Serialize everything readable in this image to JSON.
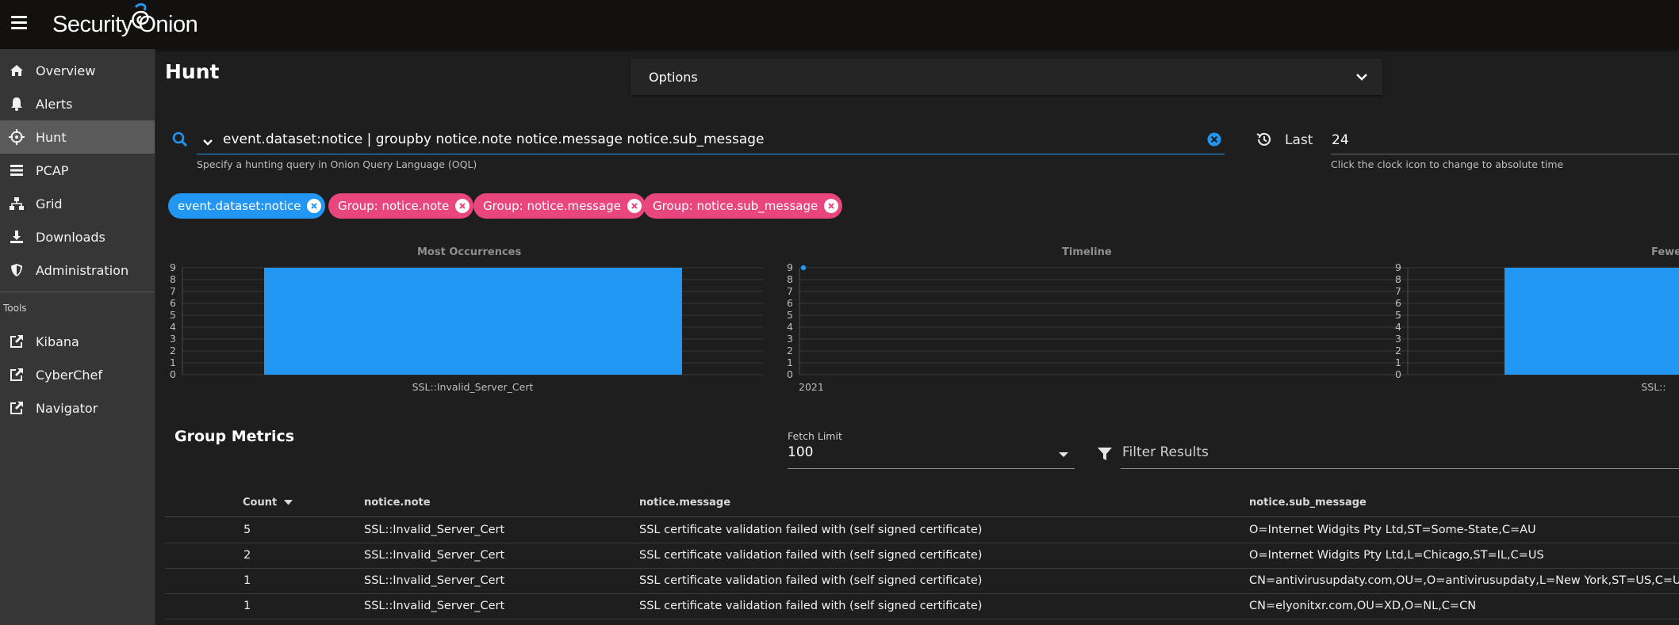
{
  "app": {
    "brand": "Security Onion",
    "brand_icon": "onion-swirl-logo",
    "accent": "#2196f3",
    "chip_pink": "#e8467c"
  },
  "sidebar": {
    "items": [
      {
        "label": "Overview",
        "icon": "home-icon"
      },
      {
        "label": "Alerts",
        "icon": "bell-icon"
      },
      {
        "label": "Hunt",
        "icon": "crosshairs-icon",
        "active": true
      },
      {
        "label": "PCAP",
        "icon": "list-icon"
      },
      {
        "label": "Grid",
        "icon": "sitemap-icon"
      },
      {
        "label": "Downloads",
        "icon": "download-icon"
      },
      {
        "label": "Administration",
        "icon": "shield-icon"
      }
    ],
    "tools_label": "Tools",
    "tools": [
      {
        "label": "Kibana",
        "icon": "external-link-icon"
      },
      {
        "label": "CyberChef",
        "icon": "external-link-icon"
      },
      {
        "label": "Navigator",
        "icon": "external-link-icon"
      }
    ]
  },
  "page": {
    "title": "Hunt"
  },
  "options": {
    "label": "Options"
  },
  "query": {
    "value": "event.dataset:notice | groupby notice.note notice.message notice.sub_message",
    "hint": "Specify a hunting query in Onion Query Language (OQL)"
  },
  "time": {
    "label": "Last",
    "value": "24",
    "hint": "Click the clock icon to change to absolute time"
  },
  "chips": [
    {
      "label": "event.dataset:notice",
      "color": "#2196f3"
    },
    {
      "label": "Group: notice.note",
      "color": "#e8467c"
    },
    {
      "label": "Group: notice.message",
      "color": "#e8467c"
    },
    {
      "label": "Group: notice.sub_message",
      "color": "#e8467c"
    }
  ],
  "chart_data": [
    {
      "type": "bar",
      "title": "Most Occurrences",
      "categories": [
        "SSL::Invalid_Server_Cert"
      ],
      "values": [
        9
      ],
      "ylim": [
        0,
        9
      ],
      "yticks": [
        "9",
        "8",
        "7",
        "6",
        "5",
        "4",
        "3",
        "2",
        "1",
        "0"
      ],
      "color": "#2196f3",
      "grid": true
    },
    {
      "type": "line",
      "title": "Timeline",
      "x": [
        "2021"
      ],
      "values": [
        9
      ],
      "ylim": [
        0,
        9
      ],
      "yticks": [
        "9",
        "8",
        "7",
        "6",
        "5",
        "4",
        "3",
        "2",
        "1",
        "0"
      ],
      "xtick_labels": [
        "2021"
      ],
      "color": "#2196f3",
      "grid": true
    },
    {
      "type": "bar",
      "title": "Fewe",
      "categories": [
        "SSL::"
      ],
      "values": [
        9
      ],
      "ylim": [
        0,
        9
      ],
      "yticks": [
        "9",
        "8",
        "7",
        "6",
        "5",
        "4",
        "3",
        "2",
        "1",
        "0"
      ],
      "color": "#2196f3",
      "grid": true
    }
  ],
  "group_metrics": {
    "title": "Group Metrics",
    "fetch_limit_label": "Fetch Limit",
    "fetch_limit_value": "100",
    "filter_placeholder": "Filter Results",
    "columns": [
      "Count",
      "notice.note",
      "notice.message",
      "notice.sub_message"
    ],
    "rows": [
      {
        "count": "5",
        "note": "SSL::Invalid_Server_Cert",
        "message": "SSL certificate validation failed with (self signed certificate)",
        "sub_message": "O=Internet Widgits Pty Ltd,ST=Some-State,C=AU"
      },
      {
        "count": "2",
        "note": "SSL::Invalid_Server_Cert",
        "message": "SSL certificate validation failed with (self signed certificate)",
        "sub_message": "O=Internet Widgits Pty Ltd,L=Chicago,ST=IL,C=US"
      },
      {
        "count": "1",
        "note": "SSL::Invalid_Server_Cert",
        "message": "SSL certificate validation failed with (self signed certificate)",
        "sub_message": "CN=antivirusupdaty.com,OU=,O=antivirusupdaty,L=New York,ST=US,C=US"
      },
      {
        "count": "1",
        "note": "SSL::Invalid_Server_Cert",
        "message": "SSL certificate validation failed with (self signed certificate)",
        "sub_message": "CN=elyonitxr.com,OU=XD,O=NL,C=CN"
      }
    ]
  }
}
